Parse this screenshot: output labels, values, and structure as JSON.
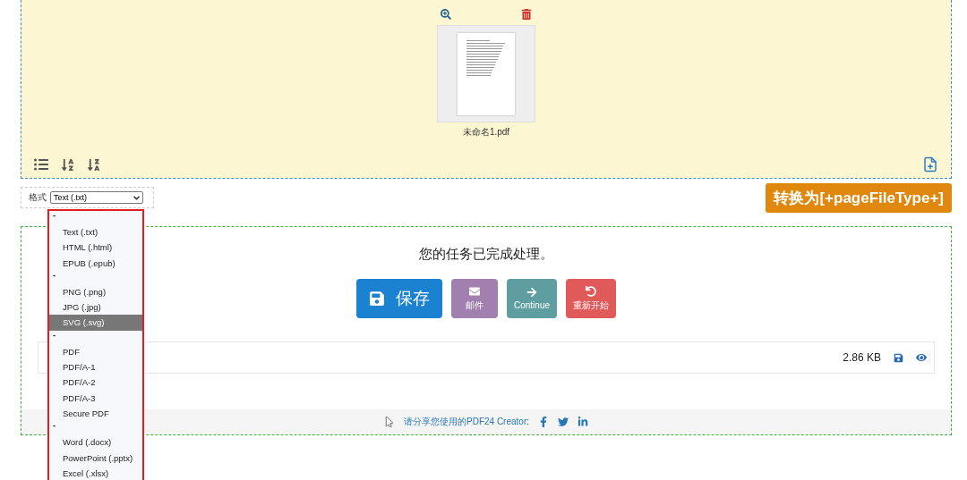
{
  "file_panel": {
    "file_name": "未命名1.pdf"
  },
  "format": {
    "label": "格式",
    "value": "Text (.txt)"
  },
  "convert_button": "转换为[+pageFileType+]",
  "dropdown": [
    {
      "label": "-",
      "options": [
        {
          "label": "Text (.txt)",
          "selected": false
        },
        {
          "label": "HTML (.html)",
          "selected": false
        },
        {
          "label": "EPUB (.epub)",
          "selected": false
        }
      ]
    },
    {
      "label": "-",
      "options": [
        {
          "label": "PNG (.png)",
          "selected": false
        },
        {
          "label": "JPG (.jpg)",
          "selected": false
        },
        {
          "label": "SVG (.svg)",
          "selected": true
        }
      ]
    },
    {
      "label": "-",
      "options": [
        {
          "label": "PDF",
          "selected": false
        },
        {
          "label": "PDF/A-1",
          "selected": false
        },
        {
          "label": "PDF/A-2",
          "selected": false
        },
        {
          "label": "PDF/A-3",
          "selected": false
        },
        {
          "label": "Secure PDF",
          "selected": false
        }
      ]
    },
    {
      "label": "-",
      "options": [
        {
          "label": "Word (.docx)",
          "selected": false
        },
        {
          "label": "PowerPoint (.pptx)",
          "selected": false
        },
        {
          "label": "Excel (.xlsx)",
          "selected": false
        }
      ]
    }
  ],
  "result": {
    "message": "您的任务已完成处理。",
    "actions": [
      {
        "kind": "save",
        "label": "保存",
        "color": "#1a82d0"
      },
      {
        "kind": "mail",
        "label": "邮件",
        "color": "#a17fae"
      },
      {
        "kind": "continue",
        "label": "Continue",
        "color": "#5f9ea0"
      },
      {
        "kind": "restart",
        "label": "重新开始",
        "color": "#e05a5a"
      }
    ],
    "file_size": "2.86 KB",
    "share_text": "请分享您使用的PDF24 Creator:"
  }
}
